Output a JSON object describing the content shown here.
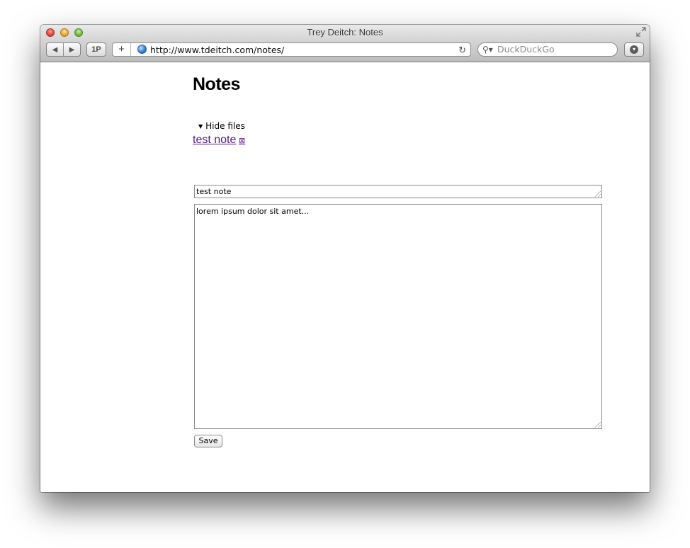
{
  "window": {
    "title": "Trey Deitch: Notes"
  },
  "toolbar": {
    "back_icon": "◀",
    "forward_icon": "▶",
    "onepassword_label": "1P",
    "add_bookmark_label": "+",
    "url": "http://www.tdeitch.com/notes/",
    "reload_icon": "↻",
    "search_placeholder": "DuckDuckGo",
    "search_icon": "⚲▾"
  },
  "page": {
    "heading": "Notes",
    "toggle_label": "Hide files",
    "toggle_icon": "▼",
    "notes": [
      {
        "label": "test note",
        "delete_icon": "⊠"
      }
    ],
    "form": {
      "title_value": "test note",
      "body_value": "lorem ipsum dolor sit amet...",
      "save_label": "Save"
    }
  },
  "icons": {
    "traffic_lights": [
      "close-icon",
      "minimize-icon",
      "zoom-icon"
    ],
    "fullscreen": "fullscreen-icon",
    "downloads": "download-icon",
    "globe": "globe-icon"
  }
}
